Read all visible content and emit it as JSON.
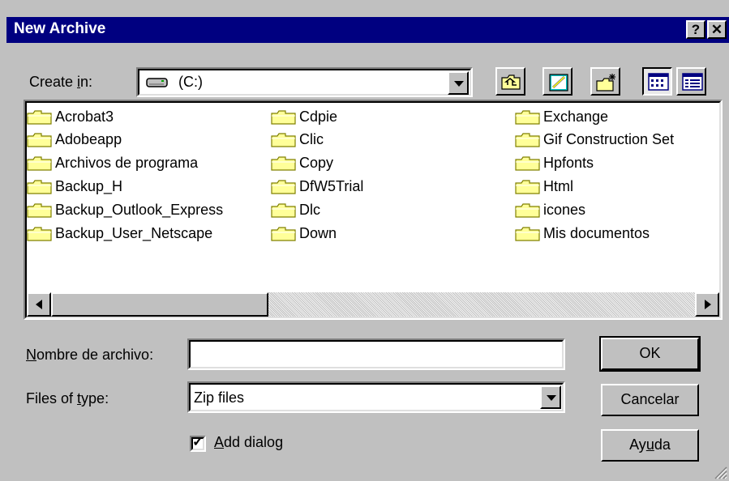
{
  "window": {
    "title": "New Archive",
    "help_glyph": "?",
    "close_glyph": "✕"
  },
  "create_in": {
    "label_pre": "Create ",
    "label_key": "i",
    "label_post": "n:",
    "value": "(C:)"
  },
  "folders": [
    "Acrobat3",
    "Adobeapp",
    "Archivos de programa",
    "Backup_H",
    "Backup_Outlook_Express",
    "Backup_User_Netscape",
    "Cdpie",
    "Clic",
    "Copy",
    "DfW5Trial",
    "Dlc",
    "Down",
    "Exchange",
    "Gif Construction Set",
    "Hpfonts",
    "Html",
    "icones",
    "Mis documentos"
  ],
  "filename": {
    "label_key": "N",
    "label_post": "ombre de archivo:",
    "value": ""
  },
  "filetype": {
    "label_pre": "Files of ",
    "label_key": "t",
    "label_post": "ype:",
    "value": "Zip files"
  },
  "add_dialog": {
    "checked": true,
    "check_glyph": "✓",
    "label_key": "A",
    "label_post": "dd dialog"
  },
  "buttons": {
    "ok": "OK",
    "cancel": "Cancelar",
    "help_pre": "Ay",
    "help_key": "u",
    "help_post": "da"
  },
  "colors": {
    "title_bar": "#000080",
    "face": "#c0c0c0",
    "folder_yellow": "#ffff99"
  }
}
